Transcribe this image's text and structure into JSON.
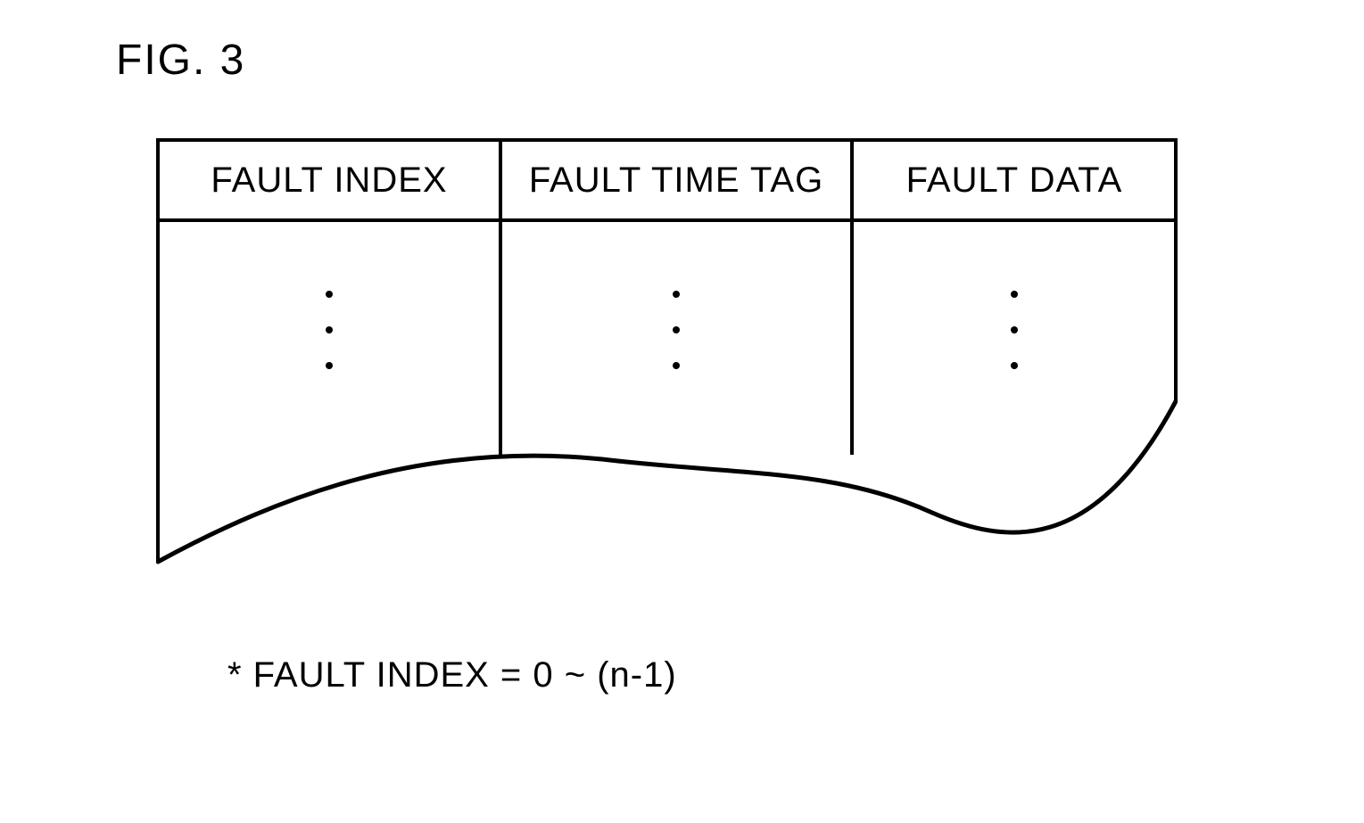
{
  "figure_label": "FIG. 3",
  "table": {
    "headers": [
      "FAULT INDEX",
      "FAULT TIME TAG",
      "FAULT DATA"
    ]
  },
  "footnote": "* FAULT INDEX = 0 ~ (n-1)"
}
